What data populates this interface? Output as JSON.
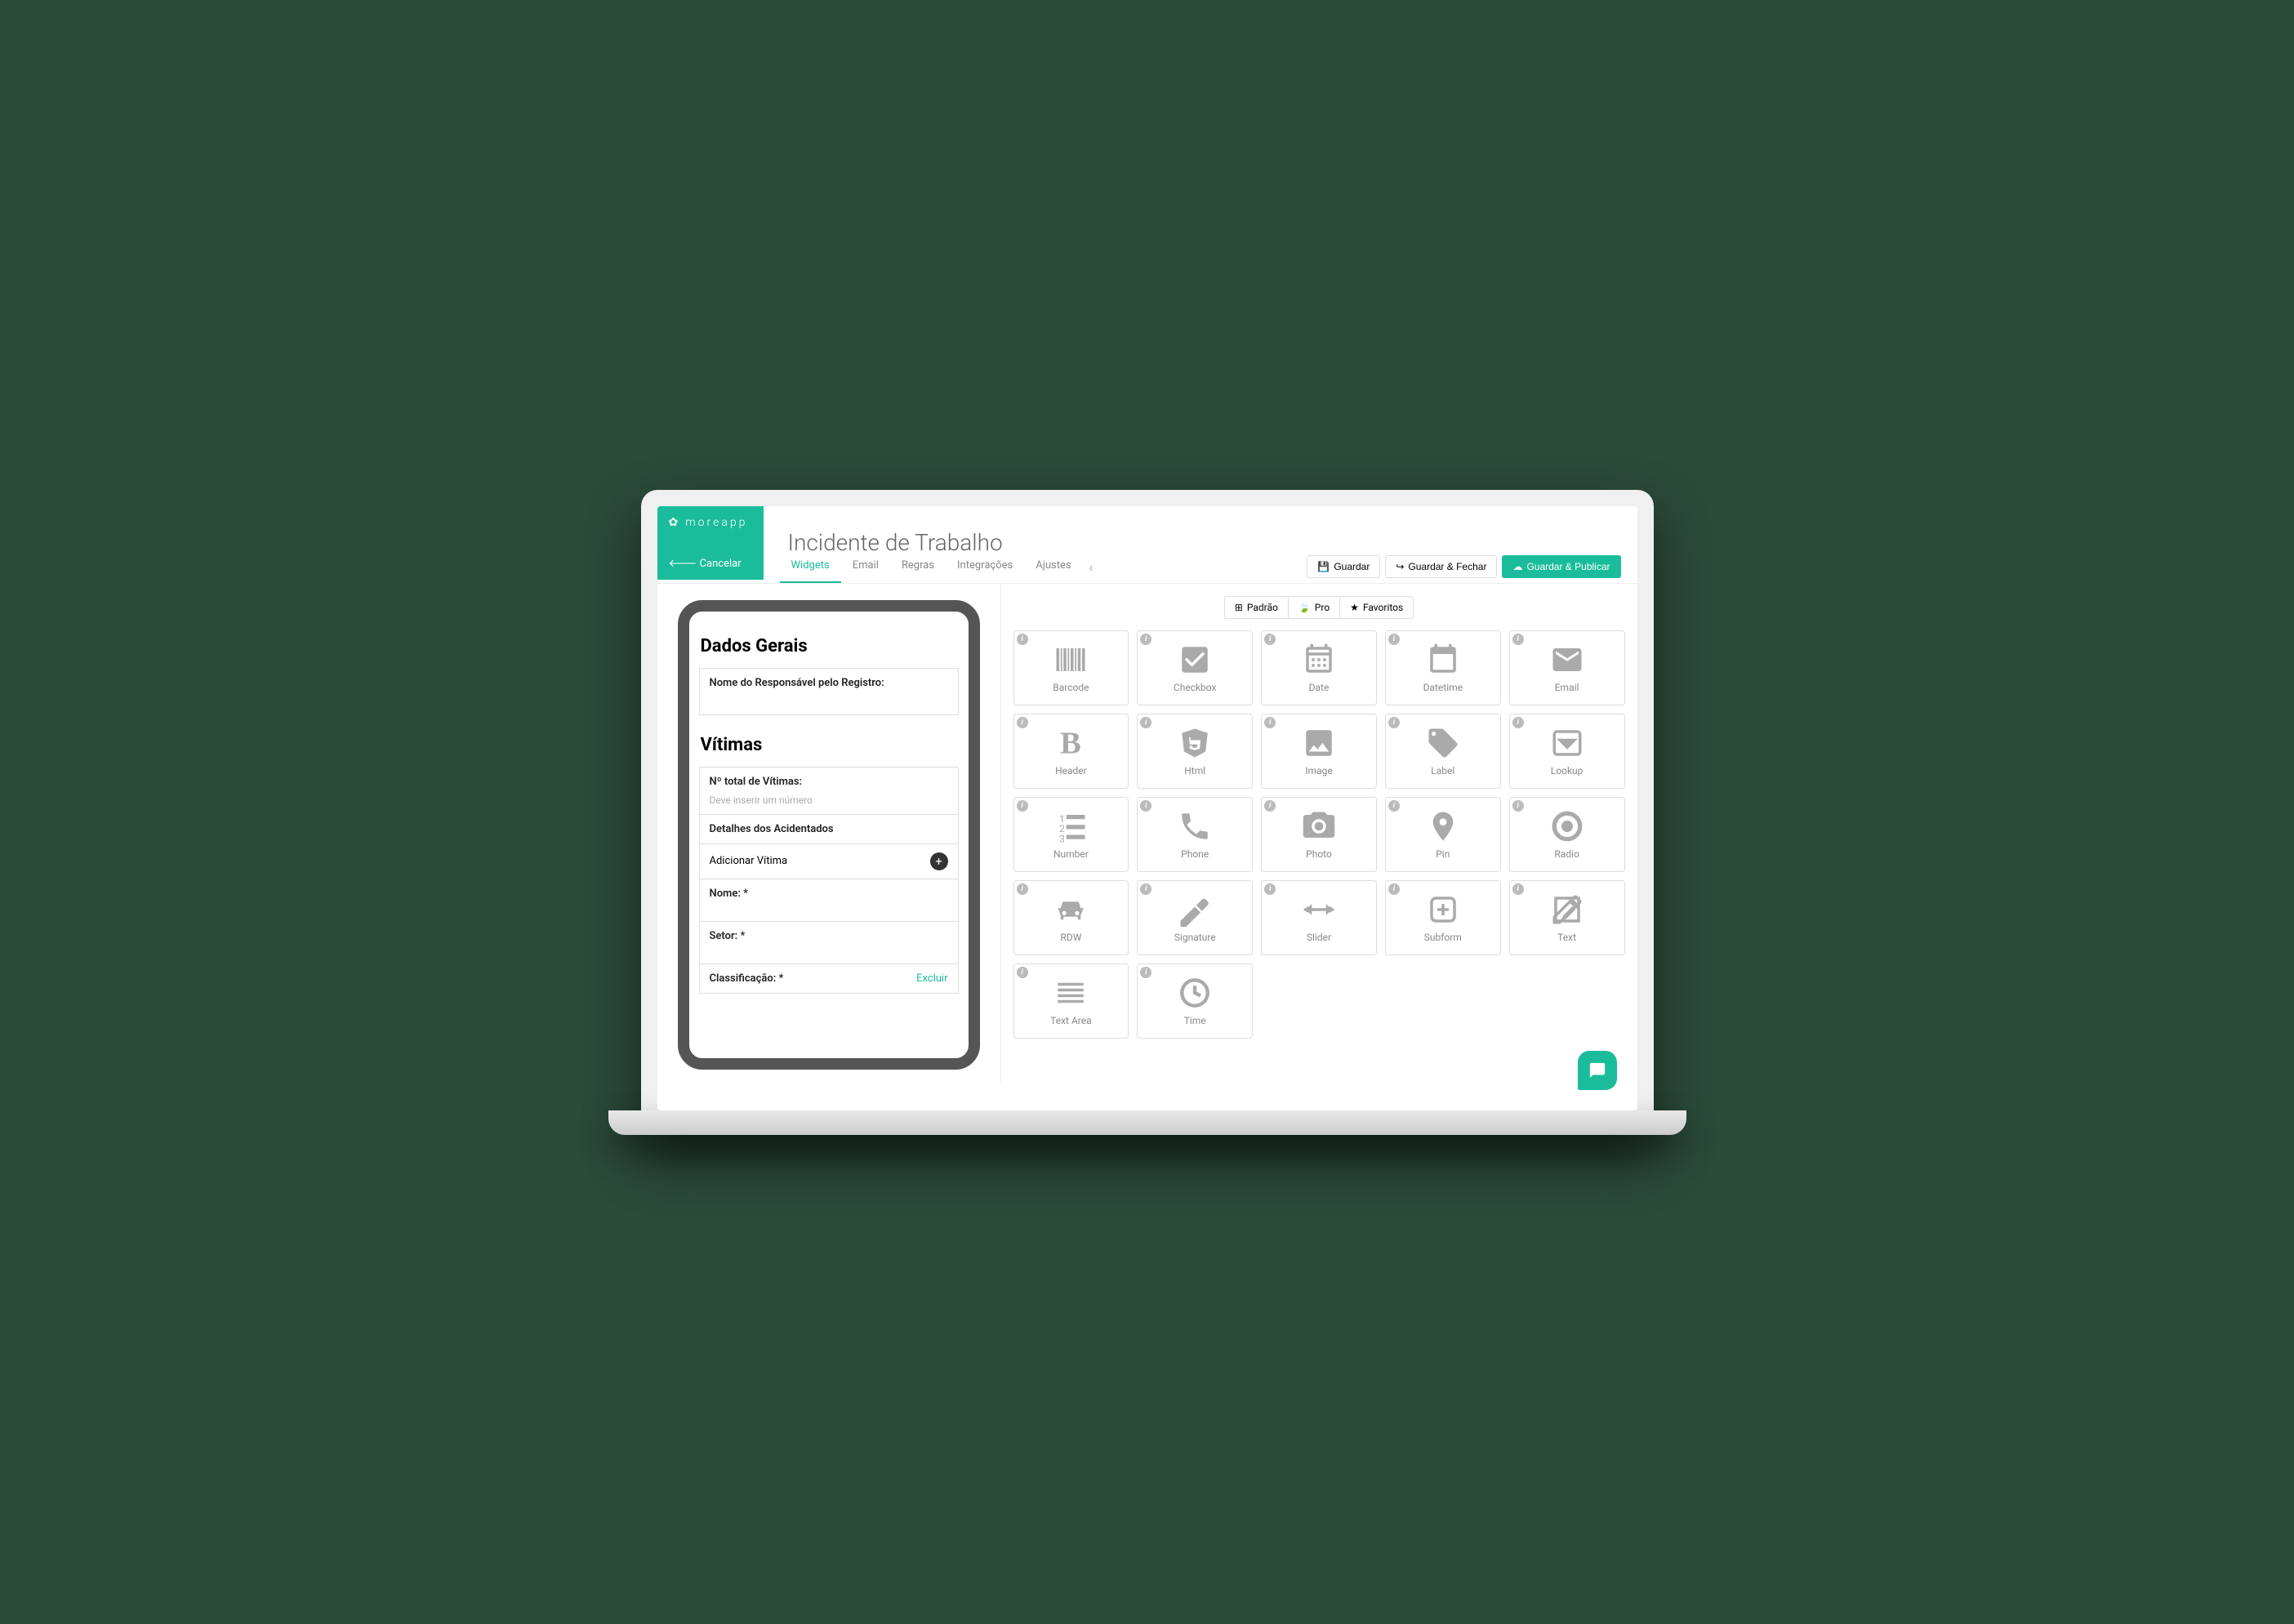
{
  "brand": "moreapp",
  "cancel": "Cancelar",
  "title": "Incidente de Trabalho",
  "tabs": [
    "Widgets",
    "Email",
    "Regras",
    "Integrações",
    "Ajustes"
  ],
  "actions": {
    "save": "Guardar",
    "saveClose": "Guardar & Fechar",
    "savePublish": "Guardar & Publicar"
  },
  "preview": {
    "section1": "Dados Gerais",
    "field1": "Nome do Responsável pelo Registro:",
    "section2": "Vítimas",
    "field2": "Nº total de Vítimas:",
    "hint2": "Deve inserir um número",
    "field3": "Detalhes dos Acidentados",
    "add": "Adicionar Vítima",
    "field4": "Nome: *",
    "field5": "Setor: *",
    "field6": "Classificação: *",
    "exclude": "Excluir"
  },
  "categories": [
    "Padrão",
    "Pro",
    "Favoritos"
  ],
  "widgets": [
    {
      "name": "Barcode",
      "icon": "barcode"
    },
    {
      "name": "Checkbox",
      "icon": "checkbox"
    },
    {
      "name": "Date",
      "icon": "date"
    },
    {
      "name": "Datetime",
      "icon": "datetime"
    },
    {
      "name": "Email",
      "icon": "email"
    },
    {
      "name": "Header",
      "icon": "header"
    },
    {
      "name": "Html",
      "icon": "html"
    },
    {
      "name": "Image",
      "icon": "image"
    },
    {
      "name": "Label",
      "icon": "label"
    },
    {
      "name": "Lookup",
      "icon": "lookup"
    },
    {
      "name": "Number",
      "icon": "number"
    },
    {
      "name": "Phone",
      "icon": "phone"
    },
    {
      "name": "Photo",
      "icon": "photo"
    },
    {
      "name": "Pin",
      "icon": "pin"
    },
    {
      "name": "Radio",
      "icon": "radio"
    },
    {
      "name": "RDW",
      "icon": "rdw"
    },
    {
      "name": "Signature",
      "icon": "signature"
    },
    {
      "name": "Slider",
      "icon": "slider"
    },
    {
      "name": "Subform",
      "icon": "subform"
    },
    {
      "name": "Text",
      "icon": "text"
    },
    {
      "name": "Text Area",
      "icon": "textarea"
    },
    {
      "name": "Time",
      "icon": "time"
    }
  ]
}
